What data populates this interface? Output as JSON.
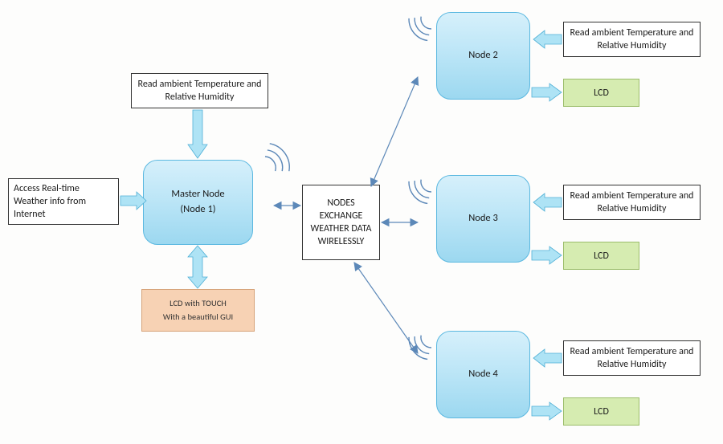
{
  "diagram": {
    "access_box": "Access Real-time Weather info from Internet",
    "sensor_label": "Read ambient Temperature and Relative Humidity",
    "master_node": "Master Node\n(Node 1)",
    "lcd_master_line1": "LCD with TOUCH",
    "lcd_master_line2": "With a beautiful GUI",
    "exchange_box": "NODES EXCHANGE WEATHER DATA WIRELESSLY",
    "node2": "Node 2",
    "node3": "Node 3",
    "node4": "Node 4",
    "lcd_label": "LCD"
  }
}
